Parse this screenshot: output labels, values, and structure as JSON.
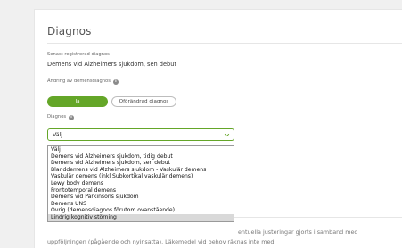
{
  "section": {
    "title": "Diagnos"
  },
  "latest": {
    "label": "Senast registrerad diagnos",
    "value": "Demens vid Alzheimers sjukdom, sen debut"
  },
  "change": {
    "label": "Ändring av demensdiagnos",
    "info_icon": "info-icon",
    "yes_label": "Ja",
    "no_label": "Oförändrad diagnos",
    "accent_color": "#64a628"
  },
  "diagnosis": {
    "label": "Diagnos",
    "selected_value": "Välj",
    "options": [
      "Välj",
      "Demens vid Alzheimers sjukdom, tidig debut",
      "Demens vid Alzheimers sjukdom, sen debut",
      "Blanddemens vid Alzheimers sjukdom - Vaskulär demens",
      "Vaskulär demens (inkl Subkortikal vaskulär demens)",
      "Lewy body demens",
      "Frontotemporal demens",
      "Demens vid Parkinsons sjukdom",
      "Demens UNS",
      "Övrig (demensdiagnos förutom ovanstående)",
      "Lindrig kognitiv störning"
    ],
    "highlighted_option": "Lindrig kognitiv störning"
  },
  "footer": {
    "line1": "entuella justeringar gjorts i samband med",
    "line2": "uppföljningen (pågående och nyinsatta). Läkemedel vid behov räknas inte med."
  }
}
